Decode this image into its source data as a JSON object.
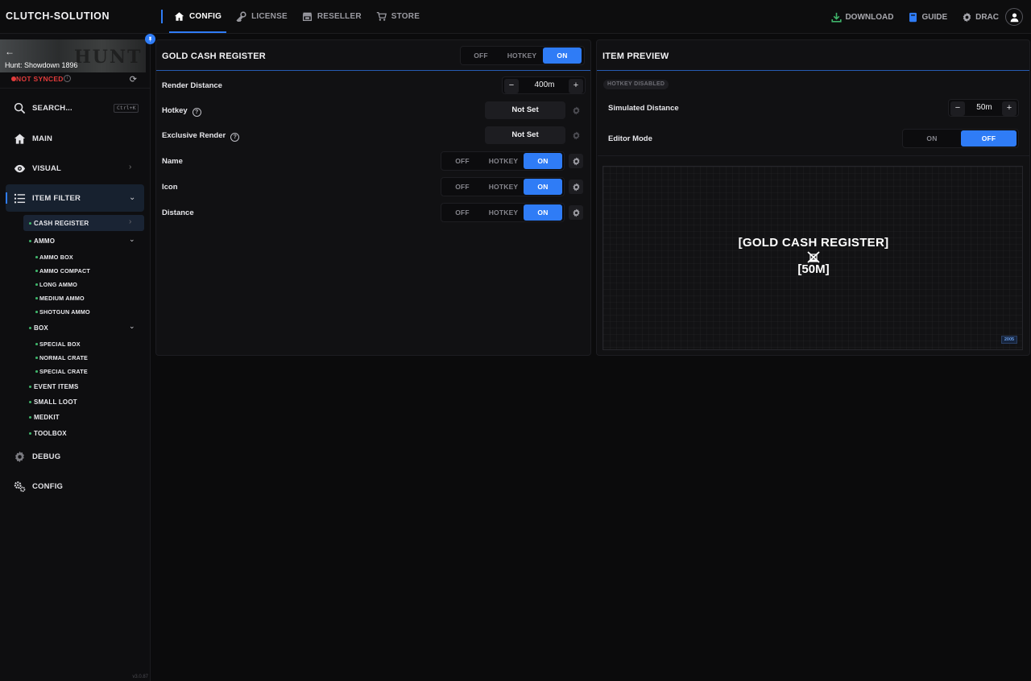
{
  "app": {
    "brand": "CLUTCH-SOLUTION",
    "version": "v3.0.87"
  },
  "nav": {
    "items": [
      {
        "label": "CONFIG",
        "icon": "home-icon",
        "active": true
      },
      {
        "label": "LICENSE",
        "icon": "key-icon",
        "active": false
      },
      {
        "label": "RESELLER",
        "icon": "store-icon",
        "active": false
      },
      {
        "label": "STORE",
        "icon": "cart-icon",
        "active": false
      }
    ],
    "right": {
      "download": "DOWNLOAD",
      "guide": "GUIDE",
      "user": "DRAC"
    }
  },
  "colors": {
    "accent": "#2f7cf6",
    "danger": "#e23b3b",
    "success": "#3fb36a",
    "download": "#3fb36a"
  },
  "sidebar": {
    "game": "Hunt: Showdown 1896",
    "banner_text": "HUNT",
    "sync_status": "NOT SYNCED",
    "search": {
      "label": "SEARCH...",
      "shortcut": "Ctrl+K"
    },
    "main": "MAIN",
    "visual": "VISUAL",
    "item_filter": "ITEM FILTER",
    "cash_register": "CASH REGISTER",
    "ammo": "AMMO",
    "ammo_items": [
      "AMMO BOX",
      "AMMO COMPACT",
      "LONG AMMO",
      "MEDIUM AMMO",
      "SHOTGUN AMMO"
    ],
    "box": "BOX",
    "box_items": [
      "SPECIAL BOX",
      "NORMAL CRATE",
      "SPECIAL CRATE"
    ],
    "event_items": "EVENT ITEMS",
    "small_loot": "SMALL LOOT",
    "medkit": "MEDKIT",
    "toolbox": "TOOLBOX",
    "debug": "DEBUG",
    "config": "CONFIG"
  },
  "settings": {
    "title": "GOLD CASH REGISTER",
    "master": {
      "off": "OFF",
      "hotkey": "HOTKEY",
      "on": "ON",
      "selected": "on"
    },
    "render_distance": {
      "label": "Render Distance",
      "value": "400m",
      "minus": "−",
      "plus": "+"
    },
    "hotkey": {
      "label": "Hotkey",
      "value": "Not Set"
    },
    "exclusive_render": {
      "label": "Exclusive Render",
      "value": "Not Set"
    },
    "name": {
      "label": "Name",
      "off": "OFF",
      "hotkey": "HOTKEY",
      "on": "ON",
      "selected": "on"
    },
    "icon": {
      "label": "Icon",
      "off": "OFF",
      "hotkey": "HOTKEY",
      "on": "ON",
      "selected": "on"
    },
    "distance": {
      "label": "Distance",
      "off": "OFF",
      "hotkey": "HOTKEY",
      "on": "ON",
      "selected": "on"
    }
  },
  "preview": {
    "title": "ITEM PREVIEW",
    "hotkey_badge": "HOTKEY DISABLED",
    "simulated_distance": {
      "label": "Simulated Distance",
      "value": "50m",
      "minus": "−",
      "plus": "+"
    },
    "editor_mode": {
      "label": "Editor Mode",
      "on": "ON",
      "off": "OFF",
      "selected": "off"
    },
    "item_name": "[GOLD CASH REGISTER]",
    "item_distance": "[50M]",
    "corner_badge": "2005"
  }
}
